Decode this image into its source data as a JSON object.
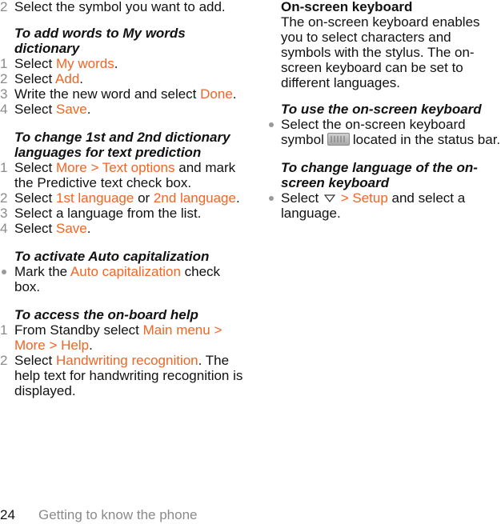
{
  "left": {
    "intro_step": {
      "num": "2",
      "text": "Select the symbol you want to add."
    },
    "sections": [
      {
        "heading": "To add words to My words dictionary",
        "steps": [
          {
            "num": "1",
            "pre": "Select ",
            "link": "My words",
            "post": "."
          },
          {
            "num": "2",
            "pre": "Select ",
            "link": "Add",
            "post": "."
          },
          {
            "num": "3",
            "pre": "Write the new word and select ",
            "link": "Done",
            "post": "."
          },
          {
            "num": "4",
            "pre": "Select ",
            "link": "Save",
            "post": "."
          }
        ]
      },
      {
        "heading": "To change 1st and 2nd dictionary languages for text prediction",
        "steps": [
          {
            "num": "1",
            "pre": "Select ",
            "link": "More > Text options",
            "post": " and mark the Predictive text check box."
          },
          {
            "num": "2",
            "pre": "Select ",
            "link": "1st language",
            "mid": " or ",
            "link2": "2nd language",
            "post": "."
          },
          {
            "num": "3",
            "text": "Select a language from the list."
          },
          {
            "num": "4",
            "pre": "Select ",
            "link": "Save",
            "post": "."
          }
        ]
      },
      {
        "heading": "To activate Auto capitalization",
        "bullet": {
          "pre": "Mark the ",
          "link": "Auto capitalization",
          "post": " check box."
        }
      },
      {
        "heading": "To access the on-board help",
        "steps": [
          {
            "num": "1",
            "pre": "From Standby select ",
            "link": "Main menu > More > Help",
            "post": "."
          },
          {
            "num": "2",
            "pre": "Select ",
            "link": "Handwriting recognition",
            "post": ". The help text for handwriting recognition is displayed."
          }
        ]
      }
    ]
  },
  "right": {
    "title": "On-screen keyboard",
    "description": "The on-screen keyboard enables you to select characters and symbols with the stylus. The on-screen keyboard can be set to different languages.",
    "use_heading": "To use the on-screen keyboard",
    "use_bullet": {
      "pre": "Select the on-screen keyboard symbol",
      "icon": "keyboard-icon",
      "post": "located in the status bar."
    },
    "lang_heading": "To change language of the on-screen keyboard",
    "lang_bullet": {
      "pre": "Select",
      "icon": "down-arrow-icon",
      "link": "> Setup",
      "post": " and select a language."
    }
  },
  "footer": {
    "page_number": "24",
    "section": "Getting to know the phone"
  },
  "colors": {
    "link": "#f26522",
    "number": "#8a8a8a",
    "text": "#111111"
  }
}
